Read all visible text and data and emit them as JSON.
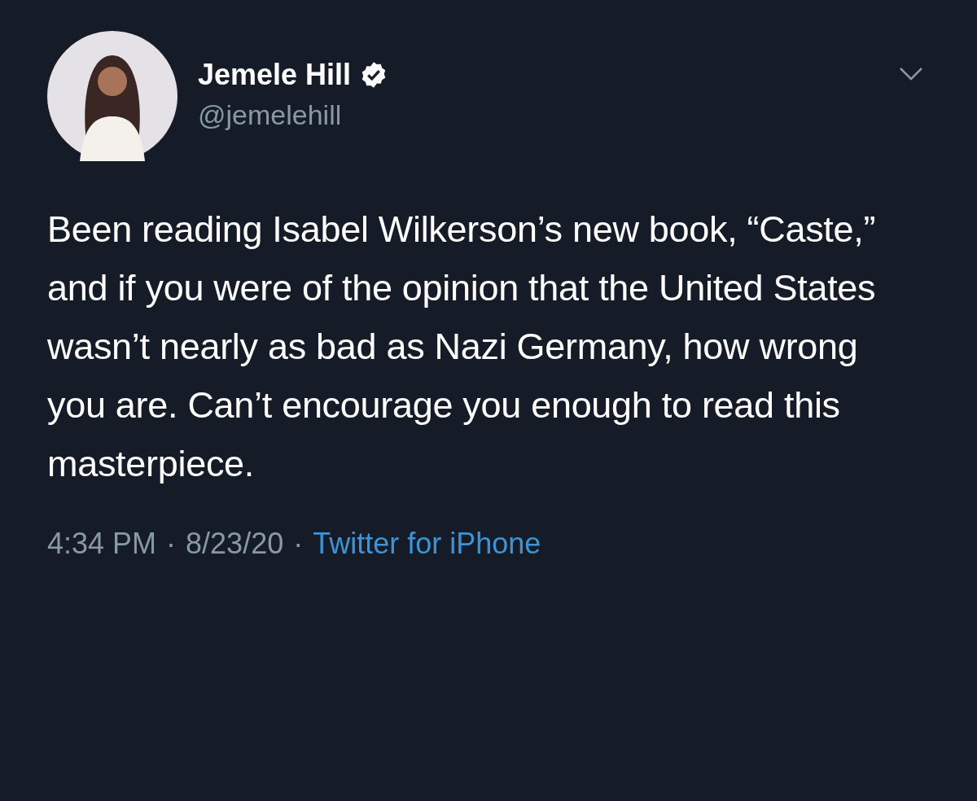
{
  "tweet": {
    "author": {
      "name": "Jemele Hill",
      "verified": true,
      "handle": "@jemelehill"
    },
    "text": "Been reading Isabel Wilkerson’s new book, “Caste,” and if you were of the opinion that the United States wasn’t nearly as bad as Nazi Germany, how wrong you are. Can’t encourage you enough to read this masterpiece.",
    "meta": [
      {
        "kind": "text",
        "text": "4:34 PM"
      },
      {
        "kind": "separator",
        "text": "·"
      },
      {
        "kind": "text",
        "text": "8/23/20"
      },
      {
        "kind": "separator",
        "text": "·"
      },
      {
        "kind": "link",
        "text": "Twitter for iPhone"
      }
    ]
  }
}
